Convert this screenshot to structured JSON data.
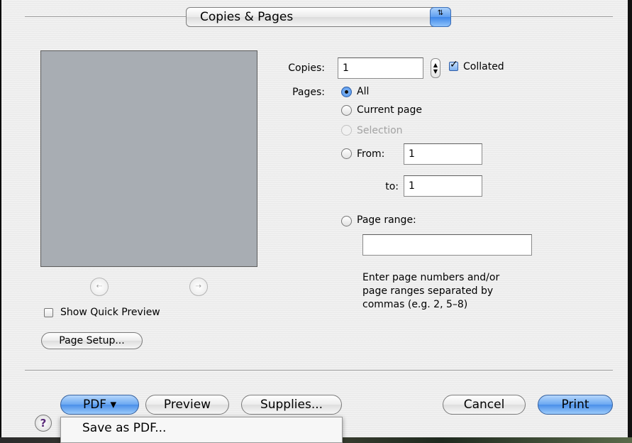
{
  "panel_popup": {
    "label": "Copies & Pages",
    "arrows": "⇅"
  },
  "preview_nav": {
    "prev_icon": "⇠",
    "next_icon": "⇢"
  },
  "quick_preview": {
    "label": "Show Quick Preview",
    "checked": false
  },
  "page_setup_button": "Page Setup...",
  "copies": {
    "label": "Copies:",
    "value": "1",
    "collated_label": "Collated",
    "collated_checked": true
  },
  "pages": {
    "label": "Pages:",
    "options": [
      {
        "label": "All",
        "selected": true,
        "enabled": true
      },
      {
        "label": "Current page",
        "selected": false,
        "enabled": true
      },
      {
        "label": "Selection",
        "selected": false,
        "enabled": false
      },
      {
        "label": "From:",
        "selected": false,
        "enabled": true
      },
      {
        "label": "Page range:",
        "selected": false,
        "enabled": true
      }
    ],
    "from_value": "1",
    "to_label": "to:",
    "to_value": "1",
    "range_value": "",
    "hint_lines": [
      "Enter page numbers and/or",
      "page ranges separated by",
      "commas (e.g. 2, 5–8)"
    ]
  },
  "footer": {
    "help": "?",
    "pdf": "PDF ▾",
    "preview": "Preview",
    "supplies": "Supplies...",
    "cancel": "Cancel",
    "print": "Print"
  },
  "pdf_menu": {
    "items": [
      "Save as PDF..."
    ]
  }
}
